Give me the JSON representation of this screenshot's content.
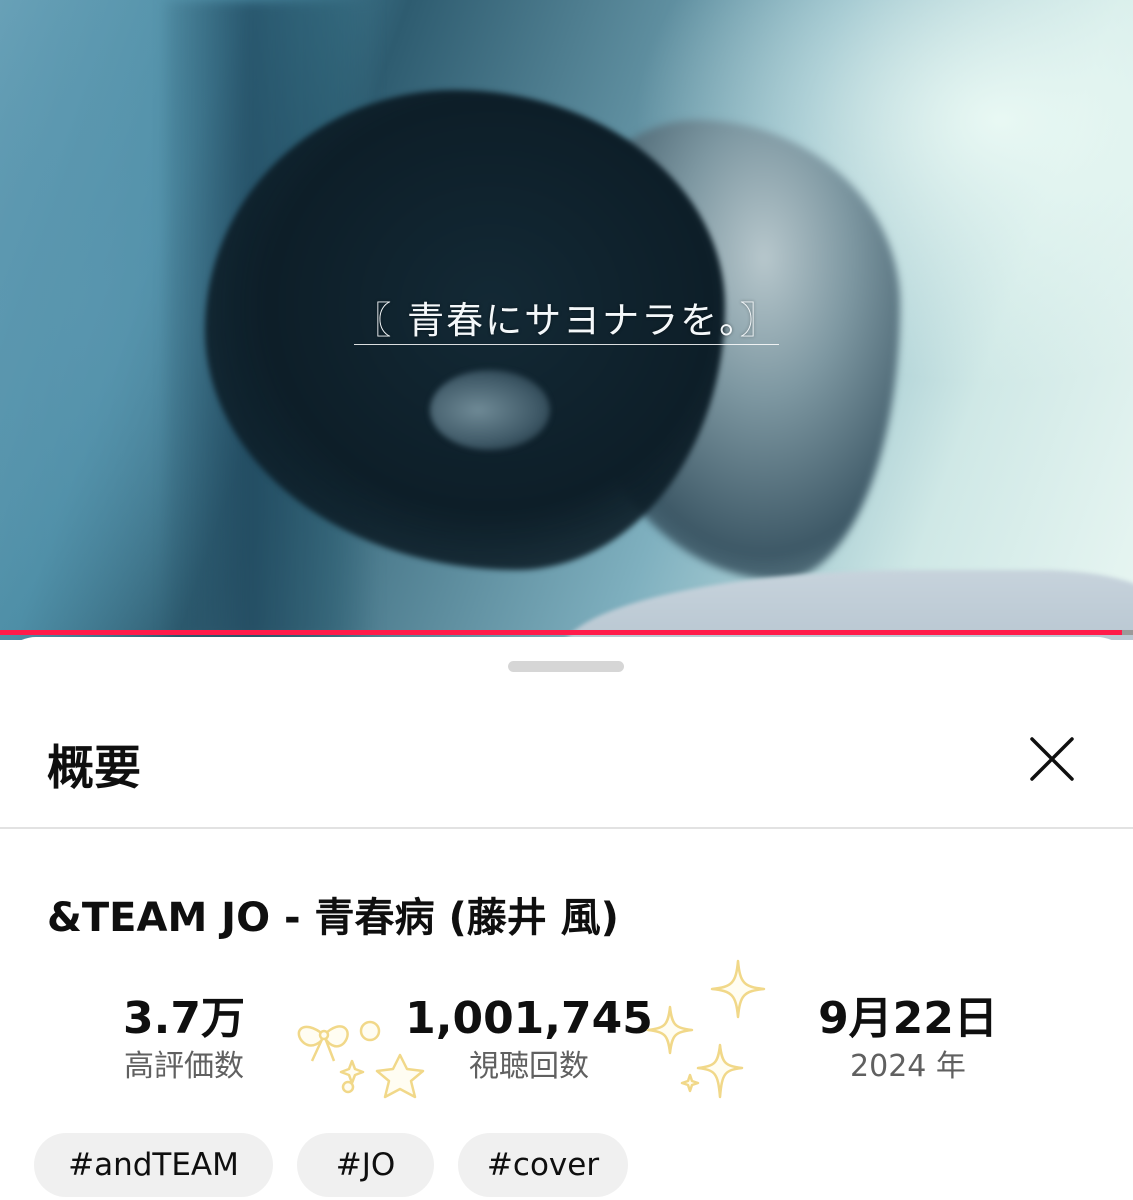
{
  "video": {
    "subtitle": "〖 青春にサヨナラを。〗",
    "progress_fraction": 0.99,
    "progress_color": "#ff1b4a"
  },
  "sheet": {
    "title": "概要",
    "close_icon": "close-icon",
    "video_title": "&TEAM JO - 青春病 (藤井 風)",
    "stats": {
      "likes": {
        "value": "3.7万",
        "label": "高評価数"
      },
      "views": {
        "value": "1,001,745",
        "label": "視聴回数"
      },
      "date": {
        "value": "9月22日",
        "label": "2024 年"
      }
    },
    "tags": [
      "#andTEAM",
      "#JO",
      "#cover"
    ]
  },
  "decorations": [
    "ribbon-sticker",
    "sparkle-sticker",
    "star-sticker"
  ]
}
